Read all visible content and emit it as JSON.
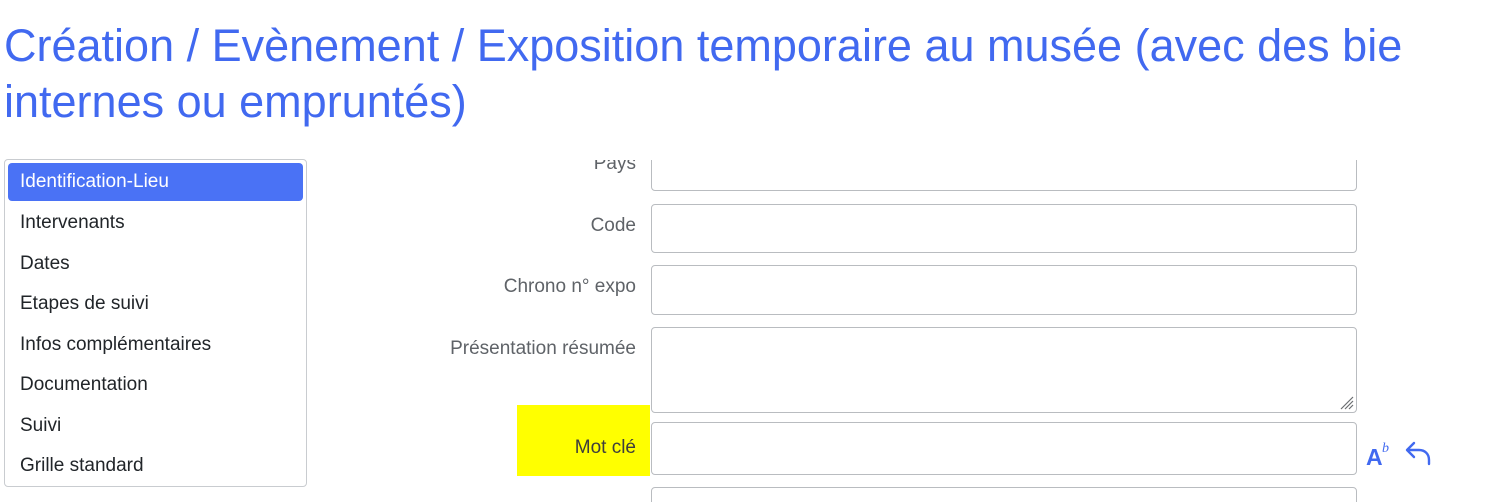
{
  "page": {
    "title_line1": "Création / Evènement / Exposition temporaire au musée (avec des bie",
    "title_line2": "internes ou empruntés)"
  },
  "sidebar": {
    "items": [
      {
        "label": "Identification-Lieu",
        "active": true
      },
      {
        "label": "Intervenants"
      },
      {
        "label": "Dates"
      },
      {
        "label": "Etapes de suivi"
      },
      {
        "label": "Infos complémentaires"
      },
      {
        "label": "Documentation"
      },
      {
        "label": "Suivi"
      },
      {
        "label": "Grille standard"
      }
    ]
  },
  "form": {
    "pays_label": "Pays",
    "pays_value": "",
    "code_label": "Code",
    "code_value": "",
    "chrono_label": "Chrono n° expo",
    "chrono_value": "",
    "presentation_label": "Présentation résumée",
    "presentation_value": "",
    "motcle_label": "Mot clé",
    "motcle_value": ""
  },
  "icons": {
    "format_text": "format-text-icon",
    "undo": "undo-icon"
  },
  "colors": {
    "accent": "#4169f0",
    "active_menu": "#4a72f5",
    "highlight": "#ffff00"
  }
}
